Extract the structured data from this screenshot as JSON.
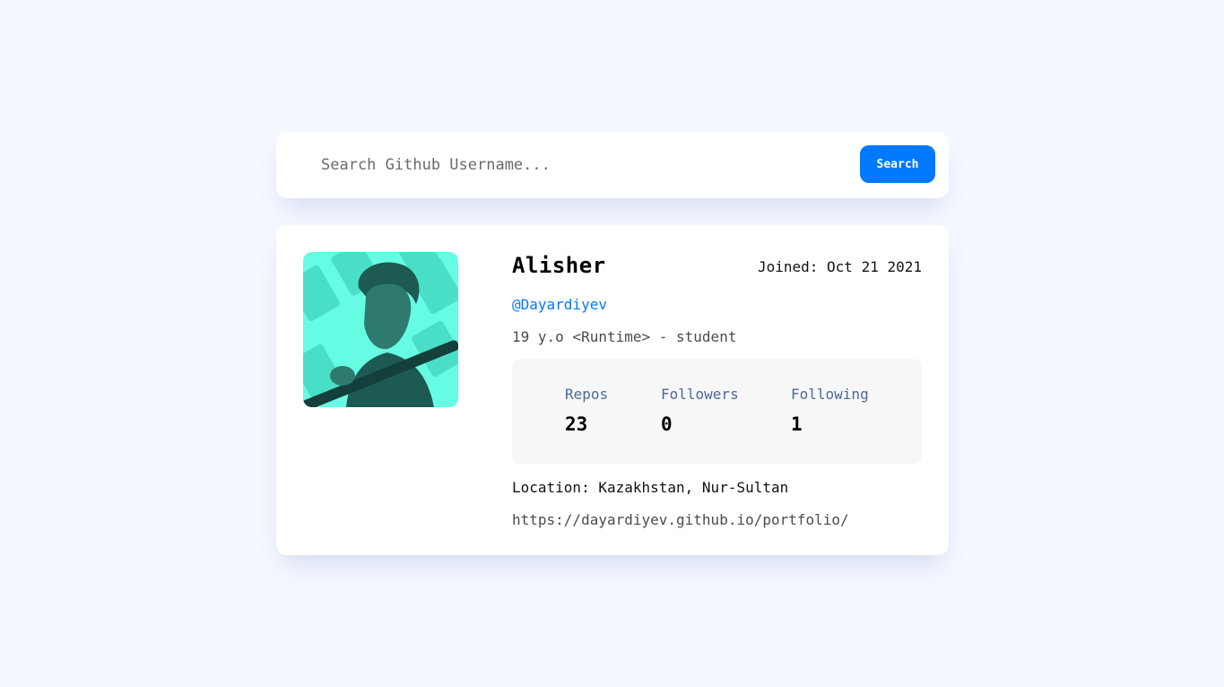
{
  "search": {
    "placeholder": "Search Github Username...",
    "value": "",
    "button_label": "Search"
  },
  "profile": {
    "name": "Alisher",
    "joined": "Joined: Oct 21 2021",
    "login": "@Dayardiyev",
    "bio": "19 y.o <Runtime> - student",
    "stats": {
      "repos_label": "Repos",
      "repos_value": "23",
      "followers_label": "Followers",
      "followers_value": "0",
      "following_label": "Following",
      "following_value": "1"
    },
    "location": "Location: Kazakhstan, Nur-Sultan",
    "blog": "https://dayardiyev.github.io/portfolio/"
  },
  "colors": {
    "page_background": "#f5f8ff",
    "accent": "#0079ff",
    "stat_label": "#4b6a9b",
    "stats_background": "#f7f7f7",
    "avatar_tint": "#66fce4"
  }
}
